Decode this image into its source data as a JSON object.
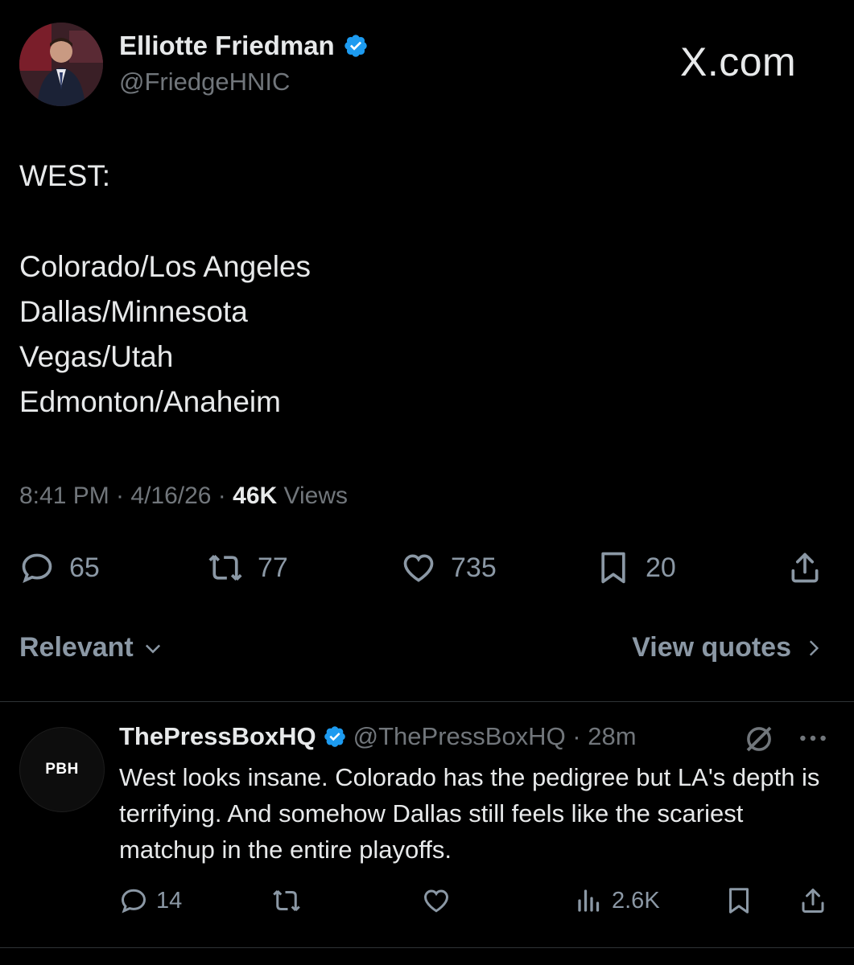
{
  "author": {
    "name": "Elliotte Friedman",
    "handle": "@FriedgeHNIC"
  },
  "brand": "X.com",
  "tweet": {
    "lines": [
      "WEST:",
      "Colorado/Los Angeles",
      "Dallas/Minnesota",
      "Vegas/Utah",
      "Edmonton/Anaheim"
    ],
    "time": "8:41 PM · 4/16/26 · ",
    "views_count": "46K",
    "views_label": " Views",
    "replies": "65",
    "reposts": "77",
    "likes": "735",
    "bookmarks": "20"
  },
  "sort_label": "Relevant",
  "view_quotes_label": "View quotes",
  "reply": {
    "avatar_text": "PBH",
    "name": "ThePressBoxHQ",
    "handle_time": "@ThePressBoxHQ · 28m",
    "text": "West looks insane. Colorado has the pedigree but LA's depth is terrifying. And somehow Dallas still feels like the scariest matchup in the entire playoffs.",
    "replies": "14",
    "views": "2.6K"
  },
  "colors": {
    "verified": "#1d9bf0",
    "background": "#000000",
    "muted": "#71767b"
  },
  "icons": [
    "verified-badge-icon",
    "reply-icon",
    "repost-icon",
    "like-icon",
    "bookmark-icon",
    "share-icon",
    "chevron-down-icon",
    "chevron-right-icon",
    "grok-icon",
    "more-icon",
    "views-icon"
  ]
}
